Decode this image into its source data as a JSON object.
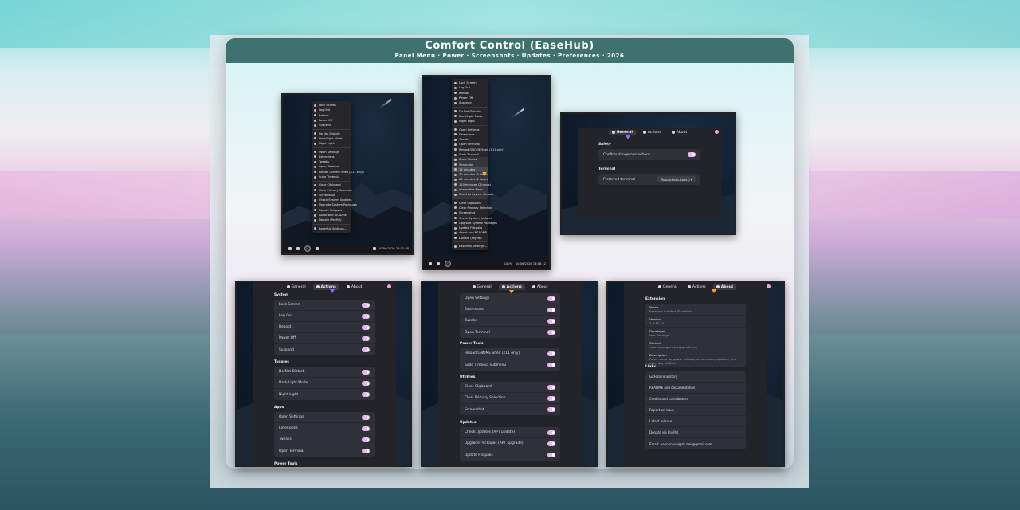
{
  "card": {
    "title": "Comfort Control (EaseHub)",
    "subtitle": "Panel Menu · Power · Screenshots · Updates · Preferences · 2026"
  },
  "menu_main": {
    "items": [
      "Lock Screen",
      "Log Out",
      "Reboot",
      "Power Off",
      "Suspend",
      "",
      "Do Not Disturb",
      "Dark/Light Mode",
      "Night Light",
      "",
      "Open Settings",
      "Extensions",
      "Tweaks",
      "Open Terminal",
      "Reload GNOME Shell (X11 only)",
      "Sudo Timeout",
      "",
      "Clear Clipboard",
      "Clear Primary Selection",
      "Screenshot",
      "Check System Updates",
      "Upgrade System Packages",
      "Update Flatpaks",
      "About and README",
      "Donate (PayPal)",
      "",
      "EaseHub Settings..."
    ]
  },
  "menu_submenu": {
    "items": [
      "Lock Screen",
      "Log Out",
      "Reboot",
      "Power Off",
      "Suspend",
      "",
      "Do Not Disturb",
      "Dark/Light Mode",
      "Night Light",
      "",
      "Open Settings",
      "Extensions",
      "Tweaks",
      "Open Terminal",
      "Reload GNOME Shell (X11 only)",
      "Sudo Timeout"
    ],
    "sub_items": [
      "Show Status",
      "5 minutes",
      "15 minutes",
      "30 minutes (5 timer)",
      "60 minutes (1 hour)",
      "120 minutes (2 hours)",
      "Interactive Menu...",
      "Reset to System Default"
    ],
    "after_items": [
      "Clear Clipboard",
      "Clear Primary Selection",
      "Screenshot",
      "Check System Updates",
      "Upgrade System Packages",
      "Update Flatpaks",
      "About and README",
      "Donate (PayPal)",
      "",
      "EaseHub Settings..."
    ]
  },
  "taskbar": {
    "left_clock_1": "10/06/2026 18:11:58",
    "left_clock_2": "10/06/2026 18:18:12",
    "zoom": "100%"
  },
  "tabs": {
    "general": "General",
    "actions": "Actions",
    "about": "About"
  },
  "general": {
    "safety_title": "Safety",
    "confirm_label": "Confirm dangerous actions",
    "terminal_title": "Terminal",
    "pref_terminal_label": "Preferred terminal",
    "pref_terminal_value": "Auto (detect best)"
  },
  "actions1": {
    "system_title": "System",
    "system": [
      "Lock Screen",
      "Log Out",
      "Reboot",
      "Power Off",
      "Suspend"
    ],
    "toggles_title": "Toggles",
    "toggles": [
      "Do Not Disturb",
      "Dark/Light Mode",
      "Night Light"
    ],
    "apps_title": "Apps",
    "apps": [
      "Open Settings",
      "Extensions",
      "Tweaks",
      "Open Terminal"
    ],
    "power_tools_title": "Power Tools"
  },
  "actions2": {
    "apps": [
      "Open Settings",
      "Extensions",
      "Tweaks",
      "Open Terminal"
    ],
    "power_tools_title": "Power Tools",
    "power_tools": [
      "Reload GNOME Shell (X11 only)",
      "Sudo Timeout submenu"
    ],
    "utilities_title": "Utilities",
    "utilities": [
      "Clear Clipboard",
      "Clear Primary Selection",
      "Screenshot"
    ],
    "updates_title": "Updates",
    "updates": [
      "Check Updates (APT update)",
      "Upgrade Packages (APT upgrade)",
      "Update Flatpaks"
    ]
  },
  "about": {
    "extension_title": "Extension",
    "name_k": "Name",
    "name_v": "EaseHub Comfort (EaseHub)",
    "version_k": "Version",
    "version_v": "2.0.40.40",
    "developer_k": "Developer",
    "developer_v": "Neo Grounge",
    "contact_k": "Contact",
    "contact_v": "neonhousegrm.dev@gmail.com",
    "description_k": "Description",
    "description_v": "Panel menu for power actions, screenshots, updates, and everyday utilities",
    "links_title": "Links",
    "links": [
      "GitHub repository",
      "README and documentation",
      "Credits and contributors",
      "Report an issue",
      "Latest release",
      "Donate via PayPal",
      "Email: neonhouselgrm.dev@gmail.com"
    ]
  },
  "colors": {
    "header": "#3f716e",
    "toggle_on": "#e7b8ee",
    "panel": "#23232a",
    "accent_cursor": "#f5a623"
  }
}
